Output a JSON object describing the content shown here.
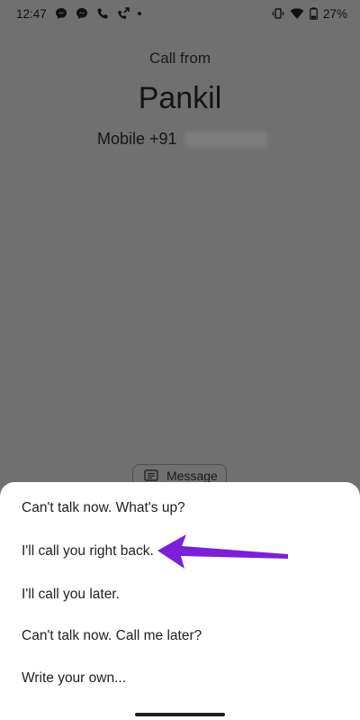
{
  "status_bar": {
    "time": "12:47",
    "battery": "27%"
  },
  "call": {
    "label": "Call from",
    "name": "Pankil",
    "number_prefix": "Mobile +91"
  },
  "message_chip": {
    "label": "Message"
  },
  "quick_replies": [
    "Can't talk now. What's up?",
    "I'll call you right back.",
    "I'll call you later.",
    "Can't talk now. Call me later?",
    "Write your own..."
  ],
  "colors": {
    "accent_arrow": "#7b1fd8",
    "dim_overlay": "#707070",
    "sheet": "#ffffff"
  },
  "icons": {
    "status_left": [
      "messenger-icon",
      "messenger-icon",
      "phone-icon",
      "missed-call-icon",
      "notification-dot-icon"
    ],
    "status_right": [
      "vibrate-icon",
      "wifi-icon",
      "battery-icon"
    ],
    "chip": "message-icon"
  }
}
